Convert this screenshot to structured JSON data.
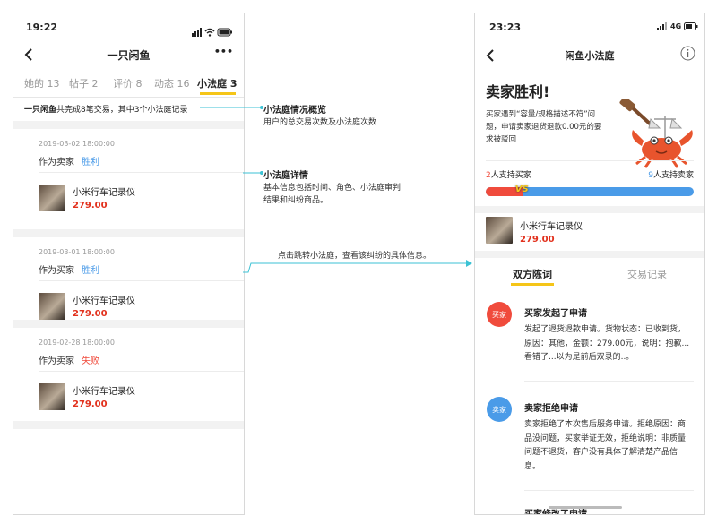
{
  "left": {
    "time": "19:22",
    "title": "一只闲鱼",
    "more": "•••",
    "tabs": [
      "她的 13",
      "帖子 2",
      "评价 8",
      "动态 16",
      "小法庭 3"
    ],
    "summary_bold": "一只闲鱼",
    "summary_rest": "共完成8笔交易，其中3个小法庭记录",
    "records": [
      {
        "date": "2019-03-02 18:00:00",
        "role": "作为卖家",
        "result": "胜利",
        "product": "小米行车记录仪",
        "price": "279.00"
      },
      {
        "date": "2019-03-01 18:00:00",
        "role": "作为买家",
        "result": "胜利",
        "product": "小米行车记录仪",
        "price": "279.00"
      },
      {
        "date": "2019-02-28 18:00:00",
        "role": "作为卖家",
        "result": "失败",
        "product": "小米行车记录仪",
        "price": "279.00"
      }
    ]
  },
  "annotations": [
    {
      "title": "小法庭情况概览",
      "text": "用户的总交易次数及小法庭次数"
    },
    {
      "title": "小法庭详情",
      "text": "基本信息包括时间、角色、小法庭审判结果和纠纷商品。"
    },
    {
      "title": "",
      "text": "点击跳转小法庭，查看该纠纷的具体信息。"
    }
  ],
  "right": {
    "time": "23:23",
    "network": "4G",
    "title": "闲鱼小法庭",
    "verdict": "卖家胜利!",
    "verdict_desc": "买家遇到“容量/规格描述不符”问题，申请卖家退货退款0.00元的要求被驳回",
    "buyer_support_num": "2",
    "buyer_support_text": "人支持买家",
    "seller_support_num": "9",
    "seller_support_text": "人支持卖家",
    "vs": "VS",
    "buyer_ratio": 0.18,
    "product": "小米行车记录仪",
    "price": "279.00",
    "tabs": [
      "双方陈词",
      "交易记录"
    ],
    "statements": [
      {
        "avatar": "买家",
        "title": "买家发起了申请",
        "body": "发起了退货退款申请。货物状态：已收到货，原因：其他，金额：279.00元，说明：抱歉...看错了...以为是前后双录的..。"
      },
      {
        "avatar": "卖家",
        "title": "卖家拒绝申请",
        "body": "卖家拒绝了本次售后服务申请。拒绝原因：商品没问题，买家举证无效，拒绝说明：非质量问题不退货，客户没有具体了解清楚产品信息。"
      },
      {
        "avatar": "",
        "title": "买家修改了申请",
        "body": ""
      }
    ]
  },
  "colors": {
    "accent": "#f5c518",
    "buyer": "#f04b3c",
    "seller": "#4a9be8",
    "price": "#e2311d",
    "connector": "#3bc2d4"
  }
}
